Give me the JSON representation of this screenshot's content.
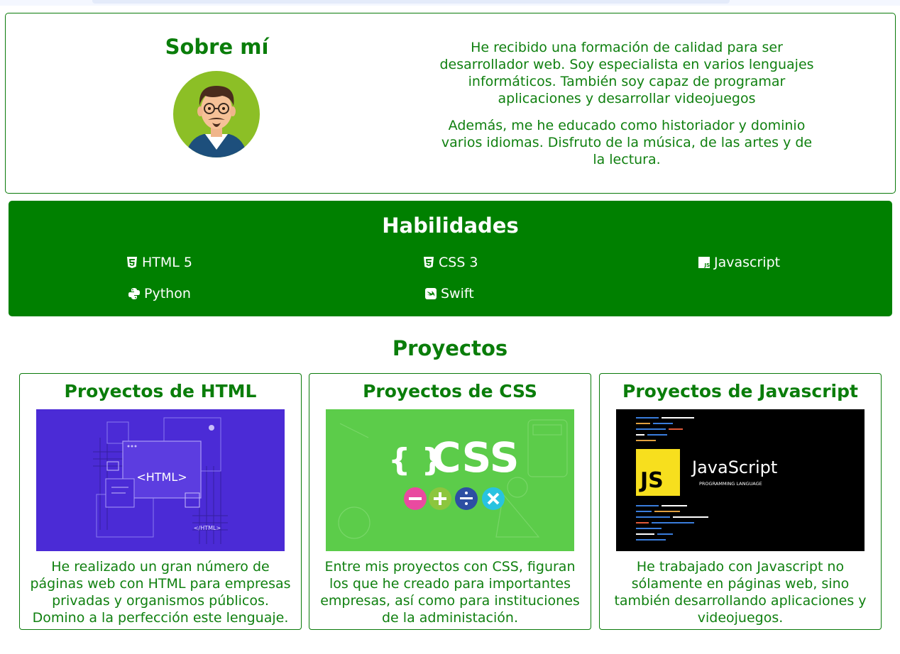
{
  "about": {
    "title": "Sobre mí",
    "paragraph1": "He recibido una formación de calidad para ser desarrollador web. Soy especialista en varios lenguajes informáticos. También soy capaz de programar aplicaciones y desarrollar videojuegos",
    "paragraph2": "Además, me he educado como historiador y dominio varios idiomas. Disfruto de la música, de las artes y de la lectura."
  },
  "skills": {
    "title": "Habilidades",
    "items": [
      {
        "label": "HTML 5",
        "icon": "html5-icon"
      },
      {
        "label": "CSS 3",
        "icon": "css3-icon"
      },
      {
        "label": "Javascript",
        "icon": "js-icon"
      },
      {
        "label": "Python",
        "icon": "python-icon"
      },
      {
        "label": "Swift",
        "icon": "swift-icon"
      }
    ]
  },
  "projects": {
    "title": "Proyectos",
    "cards": [
      {
        "title": "Proyectos de HTML",
        "image_text": "<HTML>",
        "image_corner": "</HTML>",
        "description": "He realizado un gran número de páginas web con HTML para empresas privadas y organismos públicos. Domino a la perfección este lenguaje."
      },
      {
        "title": "Proyectos de CSS",
        "image_braces": "{ }",
        "image_text": "CSS",
        "description": "Entre mis proyectos con CSS, figuran los que he creado para importantes empresas, así como para instituciones de la administación."
      },
      {
        "title": "Proyectos de Javascript",
        "image_badge": "JS",
        "image_text": "JavaScript",
        "image_subtext": "PROGRAMMING LANGUAGE",
        "description": "He trabajado con Javascript no sólamente en páginas web, sino también desarrollando aplicaciones y videojuegos."
      }
    ]
  },
  "colors": {
    "primary_green": "#008000",
    "html_bg": "#4b2bd6",
    "css_bg": "#5ccc4a",
    "js_bg": "#000000",
    "js_yellow": "#f7df1e"
  }
}
